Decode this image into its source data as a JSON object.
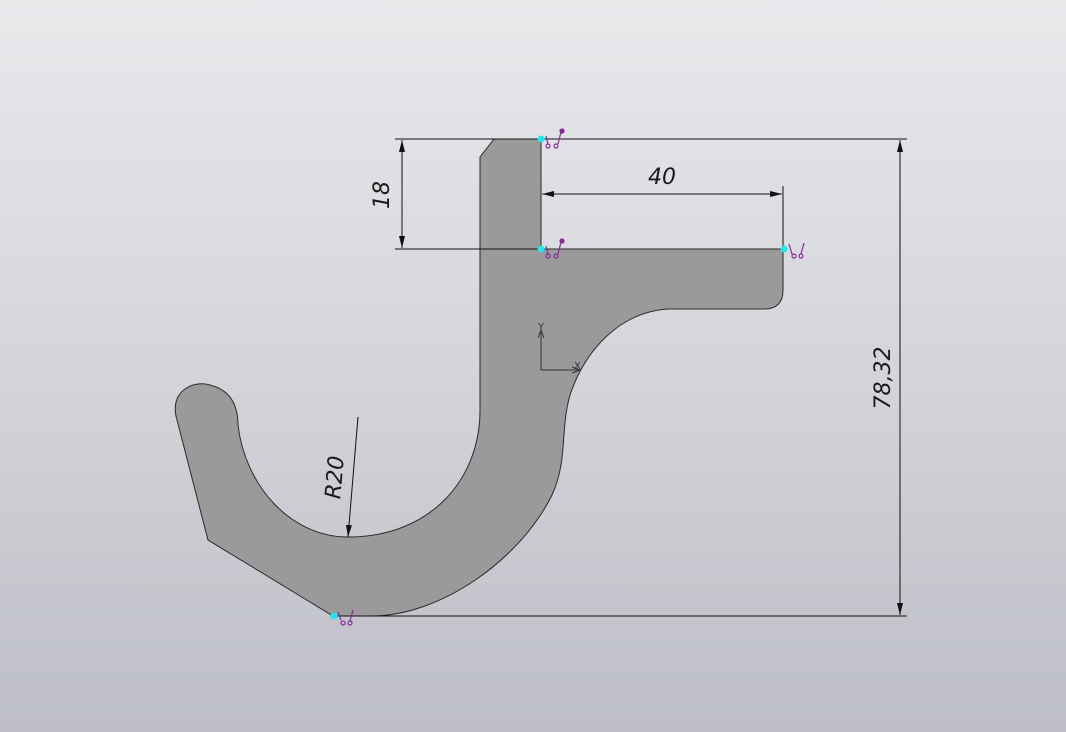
{
  "drawing": {
    "part_fill": "#9a9a9a",
    "outline_color": "#2a2a2a",
    "dimension_color": "#111111",
    "point_color": "#22e6ee",
    "constraint_color": "#8a2a9a"
  },
  "dimensions": {
    "height_top": "18",
    "width_top": "40",
    "overall_height": "78,32",
    "radius": "R20"
  },
  "axes": {
    "x_label": "X",
    "y_label": "Y"
  }
}
